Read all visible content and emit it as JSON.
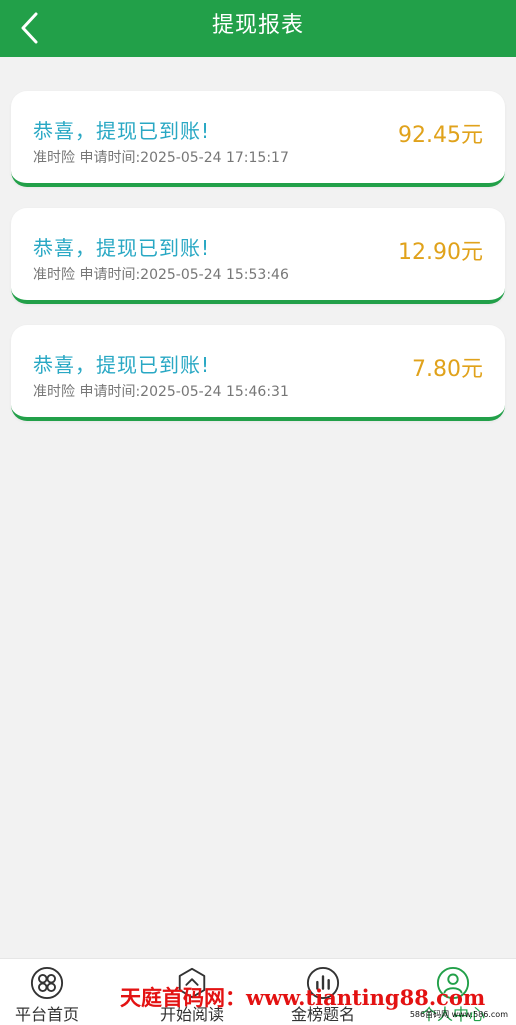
{
  "header": {
    "title": "提现报表",
    "back_icon": "chevron-left-icon",
    "background": "#22a049"
  },
  "records": [
    {
      "title": "恭喜，提现已到账!",
      "detail": "准时险 申请时间:2025-05-24 17:15:17",
      "amount": "92.45元"
    },
    {
      "title": "恭喜，提现已到账!",
      "detail": "准时险 申请时间:2025-05-24 15:53:46",
      "amount": "12.90元"
    },
    {
      "title": "恭喜，提现已到账!",
      "detail": "准时险 申请时间:2025-05-24 15:46:31",
      "amount": "7.80元"
    }
  ],
  "tabbar": {
    "items": [
      {
        "label": "平台首页",
        "icon": "grid-flower-icon",
        "active": false
      },
      {
        "label": "开始阅读",
        "icon": "hexagon-box-icon",
        "active": false
      },
      {
        "label": "金榜题名",
        "icon": "bar-chart-icon",
        "active": false
      },
      {
        "label": "个人中心",
        "icon": "user-icon",
        "active": true
      }
    ]
  },
  "watermark": {
    "text": "天庭首码网：www.tianting88.com",
    "small_text": "586首码网 www.586.com"
  },
  "colors": {
    "primary": "#22a049",
    "title_text": "#29a8c4",
    "amount": "#e0a21b",
    "watermark": "#e31212"
  }
}
